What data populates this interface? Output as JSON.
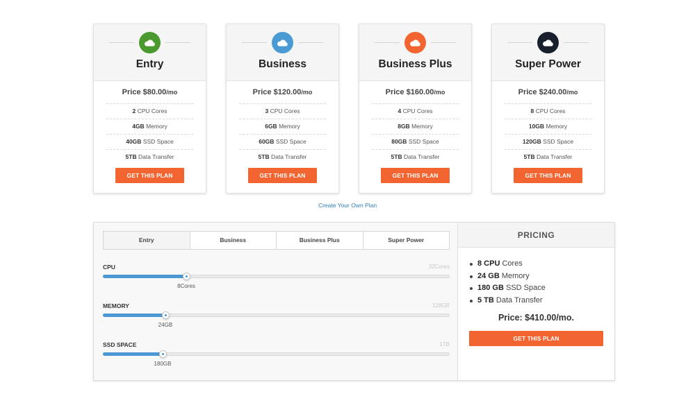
{
  "plans": [
    {
      "name": "Entry",
      "icon": "cloud-icon",
      "icon_color": "#4a9a2f",
      "price": "Price $80.00",
      "per": "/mo",
      "features": [
        {
          "value": "2",
          "label": "CPU Cores"
        },
        {
          "value": "4GB",
          "label": "Memory"
        },
        {
          "value": "40GB",
          "label": "SSD Space"
        },
        {
          "value": "5TB",
          "label": "Data Transfer"
        }
      ],
      "button": "GET THIS PLAN"
    },
    {
      "name": "Business",
      "icon": "cloud-icon",
      "icon_color": "#4a9ad4",
      "price": "Price $120.00",
      "per": "/mo",
      "features": [
        {
          "value": "3",
          "label": "CPU Cores"
        },
        {
          "value": "6GB",
          "label": "Memory"
        },
        {
          "value": "60GB",
          "label": "SSD Space"
        },
        {
          "value": "5TB",
          "label": "Data Transfer"
        }
      ],
      "button": "GET THIS PLAN"
    },
    {
      "name": "Business Plus",
      "icon": "cloud-icon",
      "icon_color": "#f26531",
      "price": "Price $160.00",
      "per": "/mo",
      "features": [
        {
          "value": "4",
          "label": "CPU Cores"
        },
        {
          "value": "8GB",
          "label": "Memory"
        },
        {
          "value": "80GB",
          "label": "SSD Space"
        },
        {
          "value": "5TB",
          "label": "Data Transfer"
        }
      ],
      "button": "GET THIS PLAN"
    },
    {
      "name": "Super Power",
      "icon": "cloud-icon",
      "icon_color": "#17202c",
      "price": "Price $240.00",
      "per": "/mo",
      "features": [
        {
          "value": "8",
          "label": "CPU Cores"
        },
        {
          "value": "10GB",
          "label": "Memory"
        },
        {
          "value": "120GB",
          "label": "SSD Space"
        },
        {
          "value": "5TB",
          "label": "Data Transfer"
        }
      ],
      "button": "GET THIS PLAN"
    }
  ],
  "create_link": "Create Your Own Plan",
  "builder": {
    "tabs": [
      "Entry",
      "Business",
      "Business Plus",
      "Super Power"
    ],
    "active_tab": 0,
    "sliders": [
      {
        "label": "CPU",
        "max": "32Cores",
        "value": "8Cores",
        "fraction": 0.24
      },
      {
        "label": "MEMORY",
        "max": "128GB",
        "value": "24GB",
        "fraction": 0.18
      },
      {
        "label": "SSD SPACE",
        "max": "1TB",
        "value": "180GB",
        "fraction": 0.173
      }
    ],
    "pricing": {
      "title": "PRICING",
      "items": [
        {
          "value": "8 CPU",
          "label": "Cores"
        },
        {
          "value": "24 GB",
          "label": "Memory"
        },
        {
          "value": "180 GB",
          "label": "SSD Space"
        },
        {
          "value": "5 TB",
          "label": "Data Transfer"
        }
      ],
      "total": "Price: $410.00/mo.",
      "button": "GET THIS PLAN"
    }
  },
  "colors": {
    "accent": "#f26531",
    "slider_fill": "#4a97d4",
    "link": "#2f7fb8"
  }
}
